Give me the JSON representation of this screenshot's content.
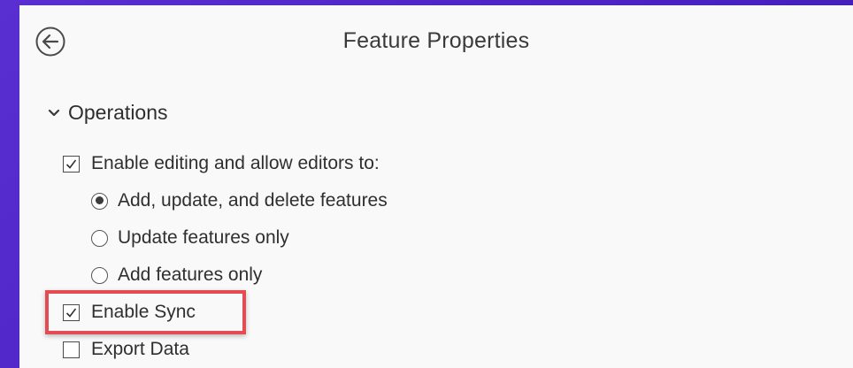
{
  "panel": {
    "title": "Feature Properties",
    "back_icon": "back-arrow-icon"
  },
  "section": {
    "label": "Operations",
    "expanded": true,
    "icon": "chevron-down-icon"
  },
  "options": {
    "enable_editing": {
      "label": "Enable editing and allow editors to:",
      "checked": true
    },
    "edit_mode": {
      "selected": "add_update_delete",
      "choices": [
        {
          "id": "add_update_delete",
          "label": "Add, update, and delete features"
        },
        {
          "id": "update_only",
          "label": "Update features only"
        },
        {
          "id": "add_only",
          "label": "Add features only"
        }
      ]
    },
    "enable_sync": {
      "label": "Enable Sync",
      "checked": true,
      "highlighted": true
    },
    "export_data": {
      "label": "Export Data",
      "checked": false
    }
  },
  "colors": {
    "background": "#4a22c4",
    "panel": "#f9f9f9",
    "highlight": "#e54b53"
  }
}
